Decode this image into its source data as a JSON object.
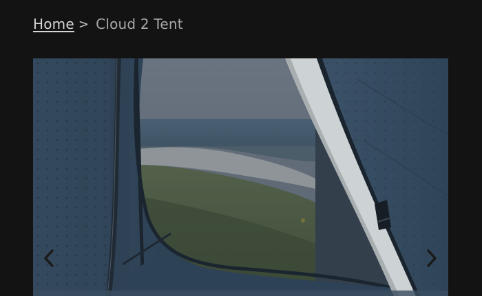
{
  "breadcrumb": {
    "home_label": "Home",
    "separator": ">",
    "current_label": "Cloud 2 Tent"
  },
  "gallery": {
    "prev_icon": "chevron-left-icon",
    "next_icon": "chevron-right-icon"
  },
  "colors": {
    "page_background": "#131313",
    "tent_fabric": "#3b5571",
    "arrow": "#1c1c1c"
  }
}
